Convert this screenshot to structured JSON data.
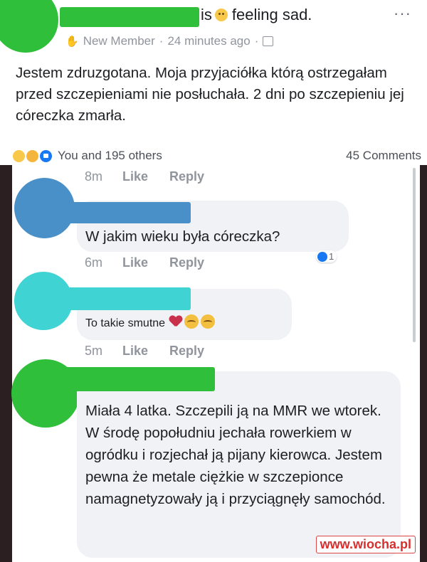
{
  "post": {
    "feeling_prefix": "is",
    "feeling_text": "feeling sad.",
    "more_label": "···",
    "meta": {
      "member_badge": "New Member",
      "time": "24 minutes ago",
      "separator": "·"
    },
    "body": "Jestem zdruzgotana. Moja przyjaciółka którą ostrzegałam przed szczepieniami nie posłuchała. 2 dni po szczepieniu jej córeczka zmarła.",
    "reactions_text": "You and 195 others",
    "comments_count": "45 Comments"
  },
  "comments": [
    {
      "time": "8m",
      "like": "Like",
      "reply": "Reply"
    },
    {
      "text": "W jakim wieku była córeczka?",
      "time": "6m",
      "like": "Like",
      "reply": "Reply",
      "like_count": "1",
      "avatar_color": "#4a90c8"
    },
    {
      "text": "To takie smutne",
      "time": "5m",
      "like": "Like",
      "reply": "Reply",
      "avatar_color": "#3fd3d3"
    },
    {
      "text": "Miała 4 latka. Szczepili ją na MMR we wtorek. W środę popołudniu jechała rowerkiem w ogródku i rozjechał ją pijany kierowca. Jestem pewna że metale ciężkie w szczepionce namagnetyzowały ją i przyciągnęły samochód.",
      "avatar_color": "#2fbf3a"
    }
  ],
  "watermark": "www.wiocha.pl",
  "colors": {
    "author_redaction": "#2fbf3a",
    "blue_redaction": "#4a90c8",
    "cyan_redaction": "#3fd3d3",
    "green_redaction": "#2fbf3a",
    "like_blue": "#1877f2"
  }
}
